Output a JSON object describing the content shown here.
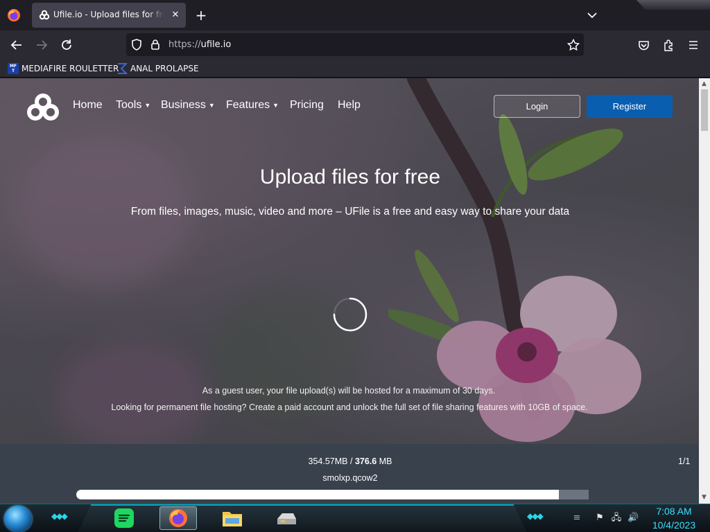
{
  "browser": {
    "tab": {
      "title": "Ufile.io - Upload files for free & easily"
    },
    "new_tab_label": "+",
    "tab_close": "✕",
    "url": {
      "scheme": "https://",
      "host": "ufile.io"
    },
    "bookmarks": [
      {
        "label": "MEDIAFIRE ROULETTER",
        "icon_text": "MF\nT"
      },
      {
        "label": "ANAL PROLAPSE",
        "icon": "sigma-icon"
      }
    ]
  },
  "site": {
    "nav": {
      "items": [
        {
          "label": "Home"
        },
        {
          "label": "Tools",
          "caret": "⌄"
        },
        {
          "label": "Business",
          "caret": "⌄"
        },
        {
          "label": "Features",
          "caret": "⌄"
        },
        {
          "label": "Pricing"
        },
        {
          "label": "Help"
        }
      ],
      "login": "Login",
      "register": "Register"
    },
    "hero": {
      "headline": "Upload files for free",
      "subheadline": "From files, images, music, video and more – UFile is a free and easy way to share your data",
      "note_guest": "As a guest user, your file upload(s) will be hosted for a maximum of 30 days.",
      "note_permanent": "Looking for permanent file hosting? Create a paid account and unlock the full set of file sharing features with 10GB of space."
    },
    "upload": {
      "uploaded": "354.57MB /",
      "total": "376.6",
      "unit": "MB",
      "count": "1/1",
      "filename": "smolxp.qcow2",
      "progress_fraction": 0.9415
    }
  },
  "colors": {
    "register_button": "#0a5eb0",
    "upload_panel": "#38414c",
    "clock": "#38e0ff"
  },
  "taskbar": {
    "time": "7:08 AM",
    "date": "10/4/2023",
    "apps": [
      "spotify-icon",
      "firefox-icon",
      "file-explorer-icon",
      "drive-icon"
    ]
  }
}
